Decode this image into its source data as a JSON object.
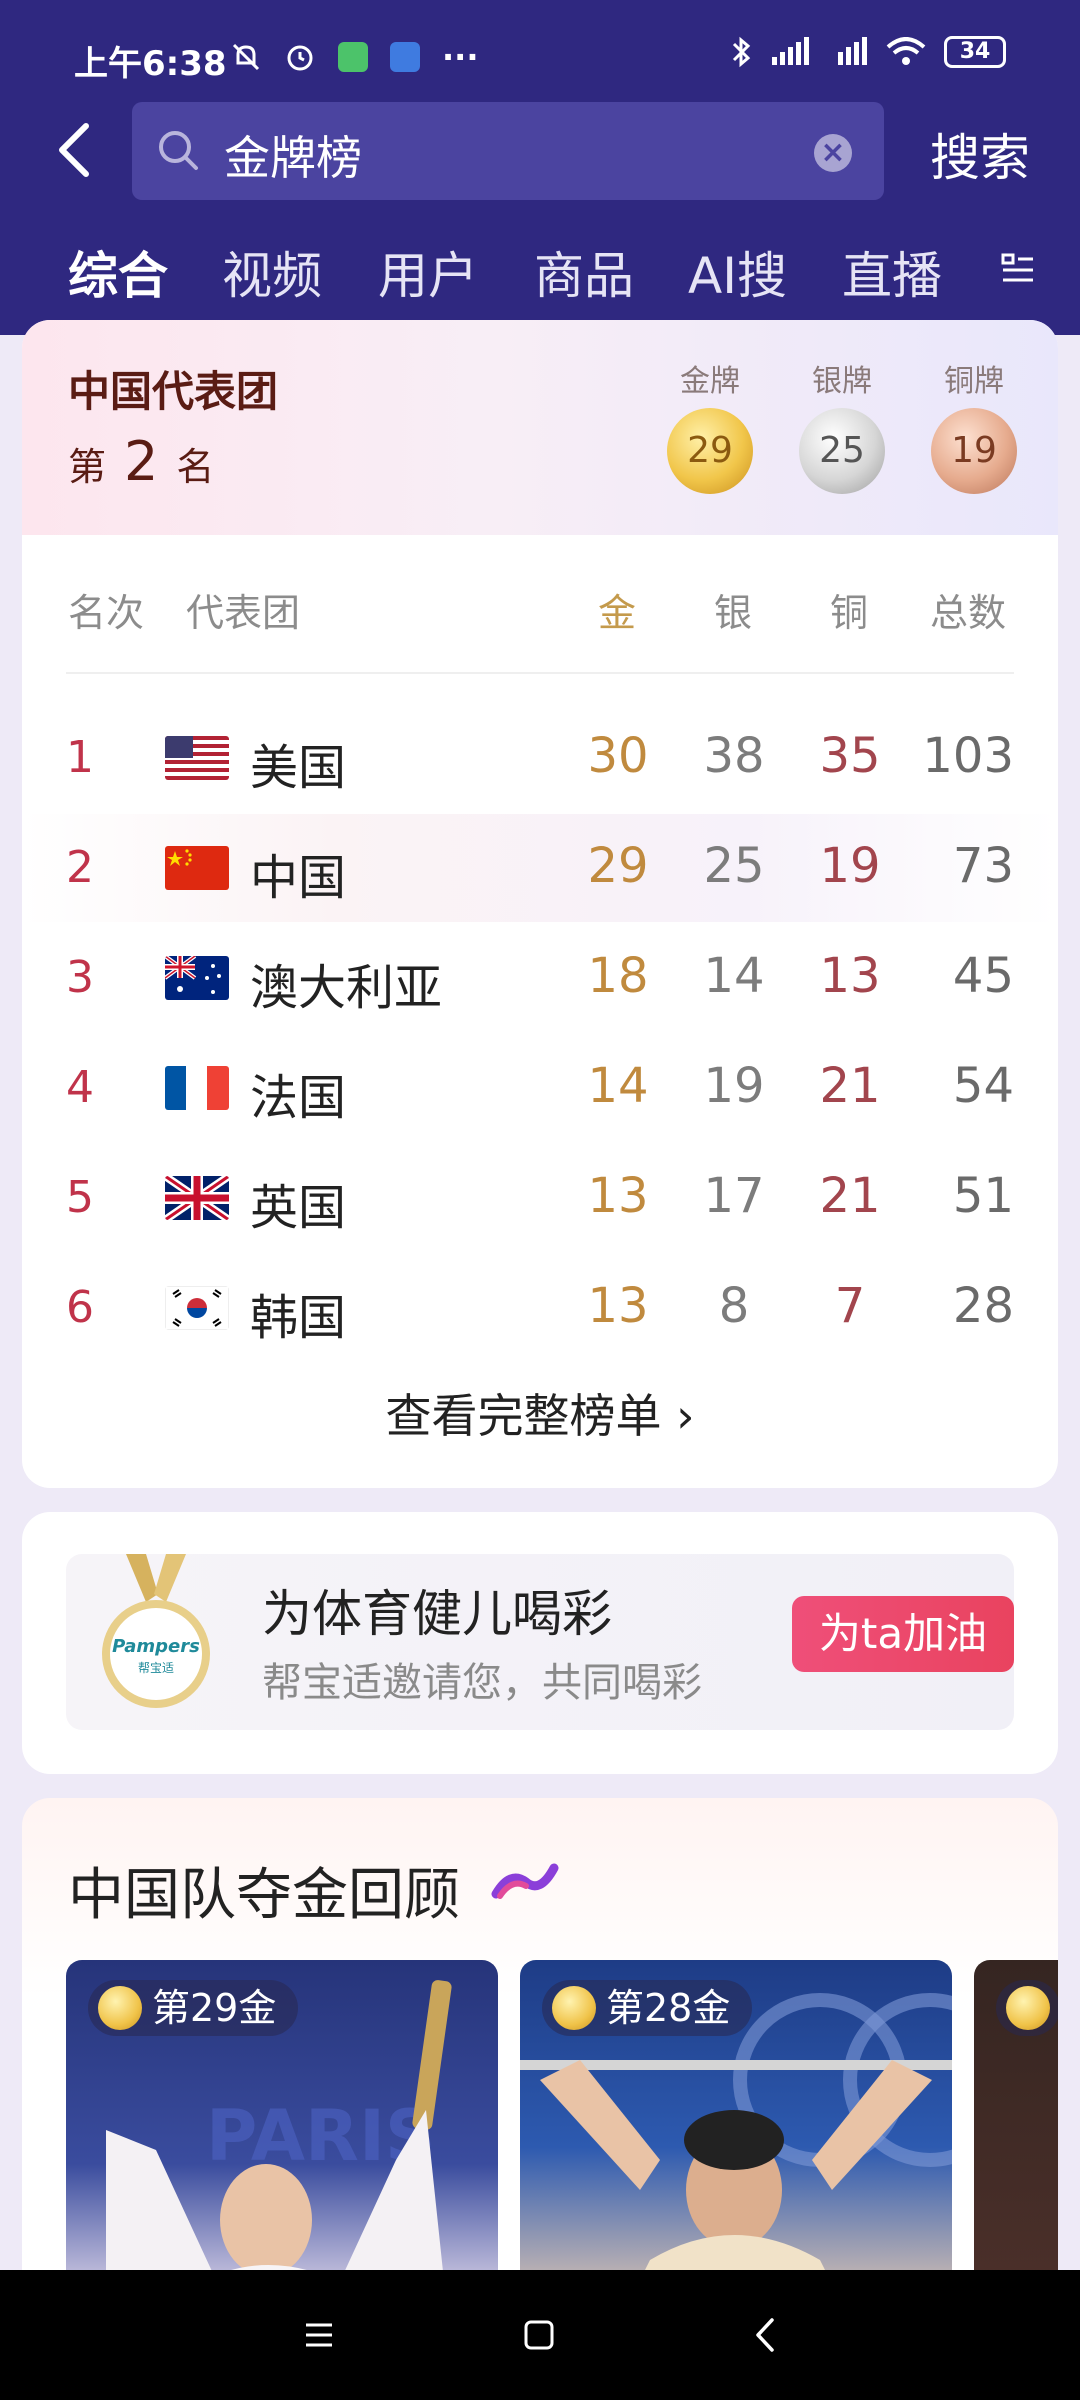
{
  "status_bar": {
    "time": "上午6:38",
    "dots": "···",
    "battery": "34"
  },
  "search": {
    "query": "金牌榜",
    "submit_label": "搜索"
  },
  "tabs": [
    {
      "label": "综合",
      "active": true
    },
    {
      "label": "视频"
    },
    {
      "label": "用户"
    },
    {
      "label": "商品"
    },
    {
      "label": "AI搜"
    },
    {
      "label": "直播"
    }
  ],
  "rank_card": {
    "delegation": "中国代表团",
    "rank_prefix": "第",
    "rank": "2",
    "rank_suffix": "名",
    "medals": {
      "gold_label": "金牌",
      "gold": "29",
      "silver_label": "银牌",
      "silver": "25",
      "bronze_label": "铜牌",
      "bronze": "19"
    }
  },
  "medal_table": {
    "headers": {
      "rank": "名次",
      "team": "代表团",
      "gold": "金",
      "silver": "银",
      "bronze": "铜",
      "total": "总数"
    },
    "rows": [
      {
        "rank": "1",
        "name": "美国",
        "gold": "30",
        "silver": "38",
        "bronze": "35",
        "total": "103"
      },
      {
        "rank": "2",
        "name": "中国",
        "gold": "29",
        "silver": "25",
        "bronze": "19",
        "total": "73"
      },
      {
        "rank": "3",
        "name": "澳大利亚",
        "gold": "18",
        "silver": "14",
        "bronze": "13",
        "total": "45"
      },
      {
        "rank": "4",
        "name": "法国",
        "gold": "14",
        "silver": "19",
        "bronze": "21",
        "total": "54"
      },
      {
        "rank": "5",
        "name": "英国",
        "gold": "13",
        "silver": "17",
        "bronze": "21",
        "total": "51"
      },
      {
        "rank": "6",
        "name": "韩国",
        "gold": "13",
        "silver": "8",
        "bronze": "7",
        "total": "28"
      }
    ],
    "see_all": "查看完整榜单 ›"
  },
  "promo": {
    "logo_text": "Pampers 帮宝适",
    "title": "为体育健儿喝彩",
    "subtitle": "帮宝适邀请您，共同喝彩",
    "cta": "为ta加油"
  },
  "gold_review": {
    "title": "中国队夺金回顾",
    "items": [
      {
        "badge": "第29金"
      },
      {
        "badge": "第28金"
      }
    ]
  },
  "colors": {
    "header_bg": "#2f2880",
    "accent_red": "#e9435f",
    "gold_text": "#c08a3e"
  }
}
